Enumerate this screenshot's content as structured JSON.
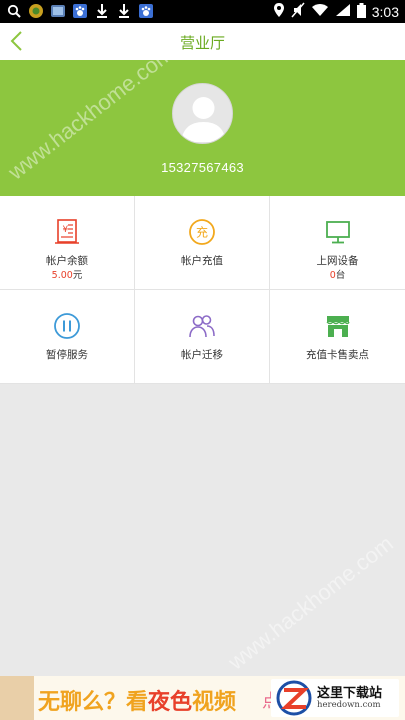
{
  "status_bar": {
    "time": "3:03",
    "left_icons": [
      "search-icon",
      "app-icon",
      "image-icon",
      "paw-icon",
      "download-icon",
      "download-icon",
      "paw-icon"
    ],
    "right_icons": [
      "location-icon",
      "mute-icon",
      "wifi-icon",
      "signal-icon",
      "battery-icon"
    ]
  },
  "nav": {
    "title": "营业厅"
  },
  "profile": {
    "phone": "15327567463"
  },
  "grid": [
    {
      "label": "帐户余额",
      "value": "5.00",
      "unit": "元",
      "icon": "balance-icon"
    },
    {
      "label": "帐户充值",
      "icon": "recharge-icon",
      "icon_text": "充"
    },
    {
      "label": "上网设备",
      "value": "0",
      "unit": "台",
      "icon": "monitor-icon"
    },
    {
      "label": "暂停服务",
      "icon": "pause-icon"
    },
    {
      "label": "帐户迁移",
      "icon": "users-icon"
    },
    {
      "label": "充值卡售卖点",
      "icon": "store-icon"
    }
  ],
  "ad": {
    "text_a": "无聊么？看",
    "text_b": "夜色",
    "text_c": "视频",
    "dot": "点",
    "logo_title": "这里下载站",
    "logo_url": "heredown.com"
  },
  "watermark": "www.hackhome.com",
  "colors": {
    "accent": "#8dc63f",
    "title": "#6aaa1f",
    "red": "#e8402a"
  }
}
